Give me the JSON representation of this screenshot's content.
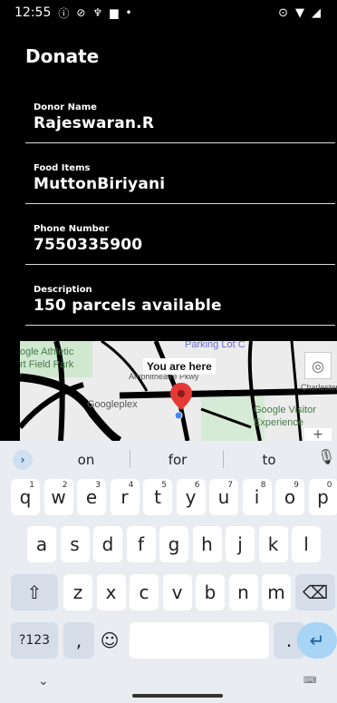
{
  "status_bar": {
    "time": "12:55",
    "icons": [
      "info-icon",
      "shield-off-icon",
      "wifi-sync-icon",
      "sim-card-icon",
      "dot-icon"
    ],
    "right_icons": [
      "location-icon",
      "wifi-icon",
      "signal-icon"
    ]
  },
  "page": {
    "title": "Donate"
  },
  "form": {
    "donor_name_label": "Donor Name",
    "donor_name_value": "Rajeswaran.R",
    "food_items_label": "Food Items",
    "food_items_value": "MuttonBiriyani",
    "phone_label": "Phone Number",
    "phone_value": "7550335900",
    "description_label": "Description",
    "description_value": "150 parcels available"
  },
  "map": {
    "marker_label": "You are here",
    "labels": {
      "athletic": "ogle Athletic",
      "field_park": "rt Field Park",
      "parking": "Parking Lot C",
      "googleplex": "Googleplex",
      "visitor": "Google Visitor",
      "experience": "Experience",
      "amphitheatre": "Amphitheatre Pkwy",
      "charleston": "Charleston"
    }
  },
  "keyboard": {
    "suggestions": [
      "on",
      "for",
      "to"
    ],
    "row1": [
      {
        "k": "q",
        "n": "1"
      },
      {
        "k": "w",
        "n": "2"
      },
      {
        "k": "e",
        "n": "3"
      },
      {
        "k": "r",
        "n": "4"
      },
      {
        "k": "t",
        "n": "5"
      },
      {
        "k": "y",
        "n": "6"
      },
      {
        "k": "u",
        "n": "7"
      },
      {
        "k": "i",
        "n": "8"
      },
      {
        "k": "o",
        "n": "9"
      },
      {
        "k": "p",
        "n": "0"
      }
    ],
    "row2": [
      "a",
      "s",
      "d",
      "f",
      "g",
      "h",
      "j",
      "k",
      "l"
    ],
    "row3": [
      "z",
      "x",
      "c",
      "v",
      "b",
      "n",
      "m"
    ],
    "symbols_key": "?123",
    "comma_key": ",",
    "period_key": ".",
    "emoji_key": "☺",
    "shift_key": "⇧",
    "backspace_key": "⌫",
    "enter_key": "↵",
    "go_icon": "›",
    "mic_icon": "🎤",
    "chevron_down": "⌄",
    "keyboard_icon": "⌨"
  }
}
